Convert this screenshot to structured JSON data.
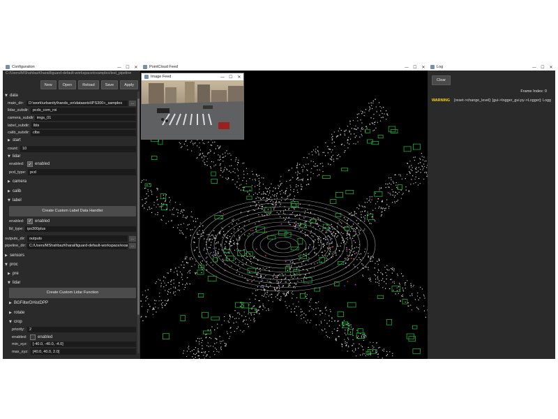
{
  "config": {
    "title": "Configuration",
    "path": "C:/Users/MShahbazKharal/liguard-default-workspace/examples/test_pipeline",
    "toolbar": [
      "New",
      "Open",
      "Reload",
      "Save",
      "Apply"
    ],
    "data": {
      "label": "data",
      "main_dir_label": "main_dir:",
      "main_dir": "D:\\work\\urbanity\\hands_on\\datasets\\IPS300+_samples",
      "lidar_subdir_label": "lidar_subdir:",
      "lidar_subdir": "pcds_com_roi",
      "camera_subdir_label": "camera_subdir:",
      "camera_subdir": "imgs_01",
      "label_subdir_label": "label_subdir:",
      "label_subdir": "lbls",
      "calib_subdir_label": "calib_subdir:",
      "calib_subdir": "clbs",
      "start_label": "start",
      "count_label": "count:",
      "count": "10",
      "lidar_label": "lidar",
      "lidar_enabled_label": "enabled:",
      "lidar_enabled_text": "enabled",
      "pcd_type_label": "pcd_type:",
      "pcd_type": "pcd",
      "camera_label": "camera",
      "calib_label": "calib",
      "label_label": "label",
      "create_label_btn": "Create Custom Label Data Handler",
      "label_enabled_label": "enabled:",
      "label_enabled_text": "enabled",
      "lbl_type_label": "lbl_type:",
      "lbl_type": "ips300plus"
    },
    "outputs_dir_label": "outputs_dir:",
    "outputs_dir": "outputs",
    "pipeline_dir_label": "pipeline_dir:",
    "pipeline_dir": "C:/Users/MShahbazKharal/liguard-default-workspace/examples",
    "sensors_label": "sensors",
    "proc_label": "proc",
    "pre_label": "pre",
    "lidar_label": "lidar",
    "create_lidar_btn": "Create Custom Lidar Function",
    "bgfilter_label": "BGFilterDHistDPP",
    "rotate_label": "rotate",
    "crop_label": "crop",
    "priority_label": "priority:",
    "priority": "2",
    "crop_enabled_label": "enabled:",
    "crop_enabled_text": "enabled",
    "min_xyz_label": "min_xyz:",
    "min_xyz": "[-40.0, -40.0, -4.0]",
    "max_xyz_label": "max_xyz:",
    "max_xyz": "[40.0, 40.0, 2.0]",
    "dots": "..."
  },
  "pointcloud": {
    "title": "PointCloud Feed"
  },
  "imagefeed": {
    "title": "Image Feed"
  },
  "log": {
    "title": "Log",
    "clear": "Clear",
    "frame_index": "Frame Index: 0",
    "level": "WARNING",
    "message": "[reset->change_level]: [gui->logger_gui.py->Logger]: Logg"
  },
  "window_controls": {
    "min": "—",
    "max": "☐",
    "close": "✕"
  },
  "colors": {
    "window_bg": "#232323",
    "cloud_bg": "#000000",
    "warning": "#ffd400",
    "box": "#1fae3a"
  }
}
